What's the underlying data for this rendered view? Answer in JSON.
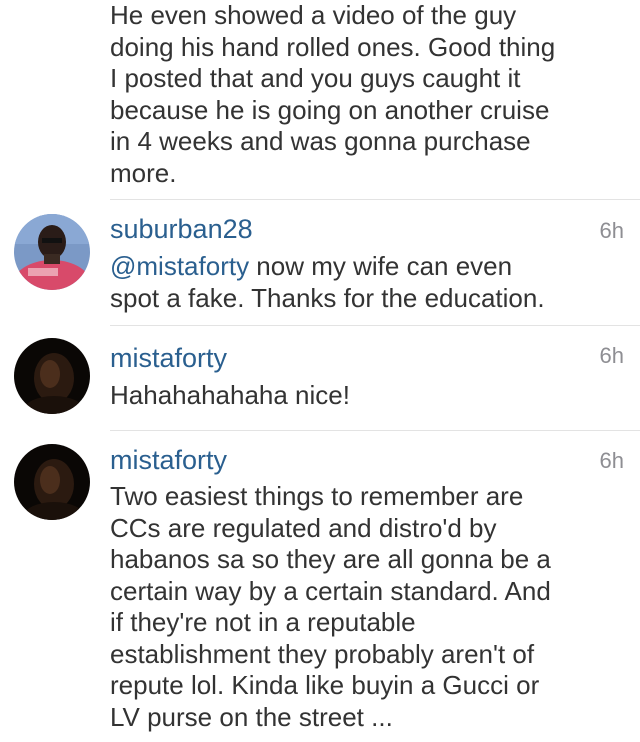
{
  "comments": [
    {
      "username": "",
      "time": "",
      "text_lines": [
        "He even showed a video of the guy",
        "doing his hand rolled ones. Good thing",
        "I posted that and you guys caught it",
        "because he is going on another cruise",
        "in 4 weeks and was gonna purchase",
        "more."
      ]
    },
    {
      "username": "suburban28",
      "time": "6h",
      "mention": "@mistaforty",
      "text_first_rest": " now my wife can even",
      "text_lines": [
        "spot a fake. Thanks for the education."
      ]
    },
    {
      "username": "mistaforty",
      "time": "6h",
      "text_lines": [
        "Hahahahahaha nice!"
      ]
    },
    {
      "username": "mistaforty",
      "time": "6h",
      "text_lines": [
        "Two easiest things to remember are",
        "CCs are regulated and distro'd by",
        "habanos sa so they are all gonna be a",
        "certain way by a certain standard. And",
        "if they're not in a reputable",
        "establishment they probably aren't of",
        "repute lol.  Kinda like buyin a Gucci or",
        "LV purse on the street ..."
      ]
    }
  ],
  "colors": {
    "username": "#2a5f8f",
    "mention": "#2a5f8f",
    "text": "#333333",
    "timestamp": "#8e8e93",
    "divider": "#e3e3e3"
  }
}
